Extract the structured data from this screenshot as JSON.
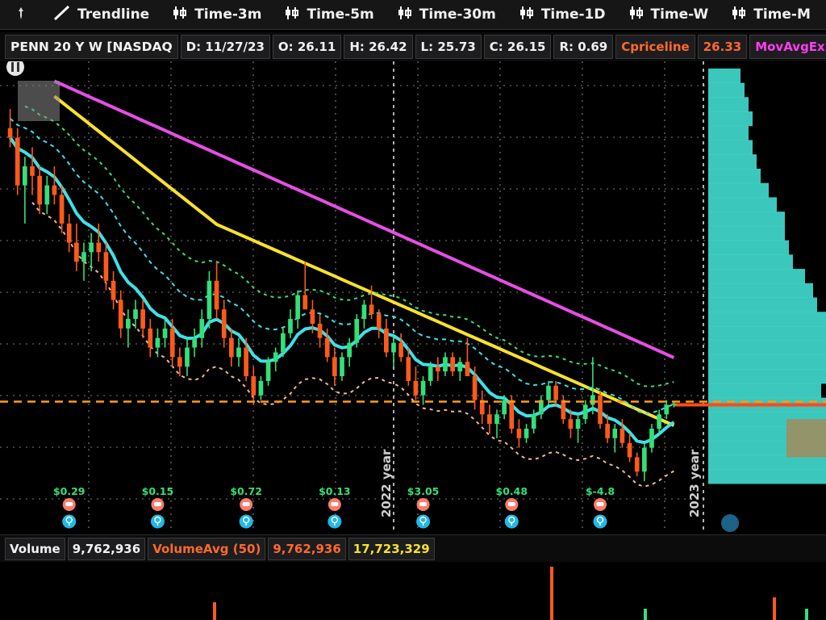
{
  "toolbar": {
    "items": [
      {
        "label": "Trendline",
        "icon": "trendline-icon"
      },
      {
        "label": "Time-3m",
        "icon": "candle-icon"
      },
      {
        "label": "Time-5m",
        "icon": "candle-icon"
      },
      {
        "label": "Time-30m",
        "icon": "candle-icon"
      },
      {
        "label": "Time-1D",
        "icon": "candle-icon"
      },
      {
        "label": "Time-W",
        "icon": "candle-icon"
      },
      {
        "label": "Time-M",
        "icon": "candle-icon"
      }
    ]
  },
  "quote": {
    "symbol": "PENN 20 Y W [NASDAQ",
    "date": "D: 11/27/23",
    "open": "O: 26.11",
    "high": "H: 26.42",
    "low": "L: 25.73",
    "close": "C: 26.15",
    "range": "R: 0.69",
    "priceline_label": "Cpriceline",
    "priceline_value": "26.33",
    "ema_label": "MovAvgExponential (CLO"
  },
  "volume": {
    "label": "Volume",
    "value": "9,762,936",
    "avg_label": "VolumeAvg (50)",
    "avg_value": "9,762,936",
    "avg50_value": "17,723,329"
  },
  "colors": {
    "bull": "#33e07a",
    "bear": "#ff5a1a",
    "cyan_ma": "#3fe0e8",
    "yellow_ma": "#f7e22a",
    "magenta_ma": "#e64ee6",
    "priceline": "#ff9a1a",
    "profile": "#40d8cc"
  },
  "chart_data": {
    "type": "candlestick",
    "timeframe": "weekly",
    "ylim": [
      18,
      62
    ],
    "year_labels": [
      "2022 year",
      "2023 year"
    ],
    "last_price": 26.33,
    "candles": [
      {
        "o": 55.0,
        "h": 57.0,
        "l": 53.0,
        "c": 54.0
      },
      {
        "o": 54.0,
        "h": 55.0,
        "l": 48.0,
        "c": 49.0
      },
      {
        "o": 49.0,
        "h": 52.0,
        "l": 45.0,
        "c": 51.0
      },
      {
        "o": 51.0,
        "h": 53.0,
        "l": 48.0,
        "c": 50.0
      },
      {
        "o": 50.0,
        "h": 51.0,
        "l": 46.0,
        "c": 47.0
      },
      {
        "o": 47.0,
        "h": 50.0,
        "l": 46.0,
        "c": 49.0
      },
      {
        "o": 49.0,
        "h": 51.0,
        "l": 47.0,
        "c": 48.0
      },
      {
        "o": 48.0,
        "h": 49.0,
        "l": 44.0,
        "c": 45.0
      },
      {
        "o": 45.0,
        "h": 46.0,
        "l": 42.0,
        "c": 43.0
      },
      {
        "o": 43.0,
        "h": 45.0,
        "l": 40.0,
        "c": 41.0
      },
      {
        "o": 41.0,
        "h": 43.0,
        "l": 39.0,
        "c": 42.0
      },
      {
        "o": 42.0,
        "h": 44.0,
        "l": 40.0,
        "c": 43.0
      },
      {
        "o": 43.0,
        "h": 45.0,
        "l": 41.0,
        "c": 42.0
      },
      {
        "o": 42.0,
        "h": 43.0,
        "l": 38.0,
        "c": 39.0
      },
      {
        "o": 39.0,
        "h": 40.0,
        "l": 36.0,
        "c": 37.0
      },
      {
        "o": 37.0,
        "h": 38.0,
        "l": 33.0,
        "c": 34.0
      },
      {
        "o": 34.0,
        "h": 36.0,
        "l": 32.0,
        "c": 35.0
      },
      {
        "o": 35.0,
        "h": 37.0,
        "l": 34.0,
        "c": 36.0
      },
      {
        "o": 36.0,
        "h": 37.0,
        "l": 33.0,
        "c": 34.0
      },
      {
        "o": 34.0,
        "h": 35.0,
        "l": 31.0,
        "c": 32.0
      },
      {
        "o": 32.0,
        "h": 34.0,
        "l": 31.0,
        "c": 33.0
      },
      {
        "o": 33.0,
        "h": 35.0,
        "l": 32.0,
        "c": 34.0
      },
      {
        "o": 34.0,
        "h": 35.0,
        "l": 30.0,
        "c": 31.0
      },
      {
        "o": 31.0,
        "h": 32.0,
        "l": 29.0,
        "c": 30.0
      },
      {
        "o": 30.0,
        "h": 33.0,
        "l": 29.0,
        "c": 32.0
      },
      {
        "o": 32.0,
        "h": 34.0,
        "l": 31.0,
        "c": 33.0
      },
      {
        "o": 33.0,
        "h": 36.0,
        "l": 32.0,
        "c": 35.0
      },
      {
        "o": 35.0,
        "h": 40.0,
        "l": 34.0,
        "c": 39.0
      },
      {
        "o": 39.0,
        "h": 41.0,
        "l": 35.0,
        "c": 36.0
      },
      {
        "o": 36.0,
        "h": 37.0,
        "l": 32.0,
        "c": 33.0
      },
      {
        "o": 33.0,
        "h": 34.0,
        "l": 30.0,
        "c": 31.0
      },
      {
        "o": 31.0,
        "h": 33.0,
        "l": 30.0,
        "c": 32.0
      },
      {
        "o": 32.0,
        "h": 33.0,
        "l": 28.5,
        "c": 29.0
      },
      {
        "o": 29.0,
        "h": 30.0,
        "l": 26.0,
        "c": 27.0
      },
      {
        "o": 27.0,
        "h": 29.0,
        "l": 26.5,
        "c": 28.5
      },
      {
        "o": 28.5,
        "h": 31.0,
        "l": 28.0,
        "c": 30.5
      },
      {
        "o": 30.5,
        "h": 32.0,
        "l": 29.5,
        "c": 31.5
      },
      {
        "o": 31.5,
        "h": 34.0,
        "l": 31.0,
        "c": 33.5
      },
      {
        "o": 33.5,
        "h": 36.0,
        "l": 33.0,
        "c": 35.0
      },
      {
        "o": 35.0,
        "h": 38.0,
        "l": 34.0,
        "c": 37.5
      },
      {
        "o": 37.5,
        "h": 41.0,
        "l": 36.5,
        "c": 36.0
      },
      {
        "o": 36.0,
        "h": 37.0,
        "l": 33.5,
        "c": 34.5
      },
      {
        "o": 34.5,
        "h": 35.5,
        "l": 32.0,
        "c": 33.0
      },
      {
        "o": 33.0,
        "h": 34.0,
        "l": 30.5,
        "c": 31.0
      },
      {
        "o": 31.0,
        "h": 32.0,
        "l": 28.0,
        "c": 29.0
      },
      {
        "o": 29.0,
        "h": 31.5,
        "l": 28.5,
        "c": 31.0
      },
      {
        "o": 31.0,
        "h": 33.0,
        "l": 30.0,
        "c": 32.5
      },
      {
        "o": 32.5,
        "h": 35.5,
        "l": 32.0,
        "c": 35.0
      },
      {
        "o": 35.0,
        "h": 37.0,
        "l": 34.0,
        "c": 36.5
      },
      {
        "o": 36.5,
        "h": 38.5,
        "l": 35.0,
        "c": 35.5
      },
      {
        "o": 35.5,
        "h": 36.0,
        "l": 33.0,
        "c": 34.0
      },
      {
        "o": 34.0,
        "h": 35.0,
        "l": 31.0,
        "c": 31.5
      },
      {
        "o": 31.5,
        "h": 33.0,
        "l": 30.0,
        "c": 32.5
      },
      {
        "o": 32.5,
        "h": 33.5,
        "l": 30.5,
        "c": 31.0
      },
      {
        "o": 31.0,
        "h": 32.0,
        "l": 28.0,
        "c": 28.5
      },
      {
        "o": 28.5,
        "h": 30.0,
        "l": 26.5,
        "c": 27.0
      },
      {
        "o": 27.0,
        "h": 29.0,
        "l": 26.0,
        "c": 28.5
      },
      {
        "o": 28.5,
        "h": 30.5,
        "l": 28.0,
        "c": 30.0
      },
      {
        "o": 30.0,
        "h": 31.0,
        "l": 28.5,
        "c": 29.5
      },
      {
        "o": 29.5,
        "h": 31.5,
        "l": 29.0,
        "c": 31.0
      },
      {
        "o": 31.0,
        "h": 31.5,
        "l": 29.0,
        "c": 29.5
      },
      {
        "o": 29.5,
        "h": 31.0,
        "l": 28.5,
        "c": 30.5
      },
      {
        "o": 30.5,
        "h": 33.0,
        "l": 29.5,
        "c": 29.0
      },
      {
        "o": 29.0,
        "h": 30.0,
        "l": 25.5,
        "c": 26.5
      },
      {
        "o": 26.5,
        "h": 27.5,
        "l": 24.0,
        "c": 25.0
      },
      {
        "o": 25.0,
        "h": 26.0,
        "l": 23.0,
        "c": 24.0
      },
      {
        "o": 24.0,
        "h": 25.5,
        "l": 22.5,
        "c": 25.0
      },
      {
        "o": 25.0,
        "h": 27.0,
        "l": 24.5,
        "c": 26.5
      },
      {
        "o": 26.5,
        "h": 27.0,
        "l": 23.0,
        "c": 23.5
      },
      {
        "o": 23.5,
        "h": 24.5,
        "l": 21.5,
        "c": 22.5
      },
      {
        "o": 22.5,
        "h": 24.0,
        "l": 22.0,
        "c": 23.5
      },
      {
        "o": 23.5,
        "h": 25.5,
        "l": 23.0,
        "c": 25.0
      },
      {
        "o": 25.0,
        "h": 27.0,
        "l": 24.5,
        "c": 26.5
      },
      {
        "o": 26.5,
        "h": 28.5,
        "l": 26.0,
        "c": 28.0
      },
      {
        "o": 28.0,
        "h": 28.5,
        "l": 26.0,
        "c": 26.5
      },
      {
        "o": 26.5,
        "h": 27.0,
        "l": 24.0,
        "c": 24.5
      },
      {
        "o": 24.5,
        "h": 25.5,
        "l": 22.5,
        "c": 23.5
      },
      {
        "o": 23.5,
        "h": 25.0,
        "l": 22.0,
        "c": 24.5
      },
      {
        "o": 24.5,
        "h": 26.5,
        "l": 24.0,
        "c": 26.0
      },
      {
        "o": 26.0,
        "h": 31.0,
        "l": 25.0,
        "c": 27.0
      },
      {
        "o": 27.0,
        "h": 27.5,
        "l": 23.5,
        "c": 24.0
      },
      {
        "o": 24.0,
        "h": 25.0,
        "l": 22.0,
        "c": 22.5
      },
      {
        "o": 22.5,
        "h": 24.0,
        "l": 21.0,
        "c": 23.5
      },
      {
        "o": 23.5,
        "h": 24.5,
        "l": 21.5,
        "c": 22.0
      },
      {
        "o": 22.0,
        "h": 23.0,
        "l": 20.0,
        "c": 20.5
      },
      {
        "o": 20.5,
        "h": 21.0,
        "l": 18.5,
        "c": 19.0
      },
      {
        "o": 19.0,
        "h": 22.0,
        "l": 18.0,
        "c": 21.5
      },
      {
        "o": 21.5,
        "h": 24.0,
        "l": 21.0,
        "c": 23.5
      },
      {
        "o": 23.5,
        "h": 25.5,
        "l": 23.0,
        "c": 25.0
      },
      {
        "o": 25.0,
        "h": 26.5,
        "l": 24.5,
        "c": 26.0
      },
      {
        "o": 26.11,
        "h": 26.42,
        "l": 25.73,
        "c": 26.15
      }
    ],
    "earnings": [
      {
        "label": "$0.29",
        "candle_index": 8
      },
      {
        "label": "$0.15",
        "candle_index": 20
      },
      {
        "label": "$0.72",
        "candle_index": 32
      },
      {
        "label": "$0.13",
        "candle_index": 44
      },
      {
        "label": "$3.05",
        "candle_index": 56
      },
      {
        "label": "$0.48",
        "candle_index": 68
      },
      {
        "label": "$-4.8",
        "candle_index": 80
      }
    ]
  }
}
